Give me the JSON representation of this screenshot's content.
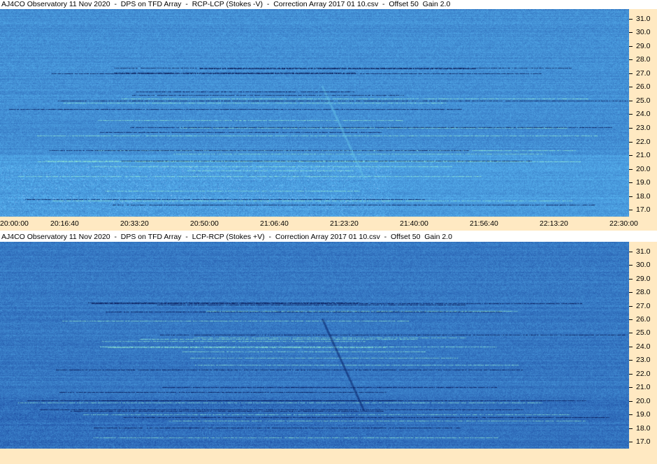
{
  "panels": [
    {
      "title": "AJ4CO Observatory 11 Nov 2020  -  DPS on TFD Array  -  RCP-LCP (Stokes -V)  -  Correction Array 2017 01 10.csv  -  Offset 50  Gain 2.0",
      "tone": "bright"
    },
    {
      "title": "AJ4CO Observatory 11 Nov 2020  -  DPS on TFD Array  -  LCP-RCP (Stokes +V)  -  Correction Array 2017 01 10.csv  -  Offset 50  Gain 2.0",
      "tone": "dark"
    }
  ],
  "x_ticks": [
    "20:00:00",
    "20:16:40",
    "20:33:20",
    "20:50:00",
    "21:06:40",
    "21:23:20",
    "21:40:00",
    "21:56:40",
    "22:13:20",
    "22:30:00"
  ],
  "colors": {
    "axis_bg": "#FFE9C2",
    "base_blue": "#1E64DC"
  },
  "chart_data": {
    "type": "heatmap",
    "x_range": [
      "20:00:00",
      "22:30:00"
    ],
    "y_range": [
      16.5,
      31.7
    ],
    "y_ticks": [
      "31.0",
      "30.0",
      "29.0",
      "28.0",
      "27.0",
      "26.0",
      "25.0",
      "24.0",
      "23.0",
      "22.0",
      "21.0",
      "20.0",
      "19.0",
      "18.0",
      "17.0"
    ],
    "xlabel": "",
    "ylabel": "",
    "series": [
      {
        "name": "RCP-LCP (Stokes -V)"
      },
      {
        "name": "LCP-RCP (Stokes +V)"
      }
    ]
  }
}
